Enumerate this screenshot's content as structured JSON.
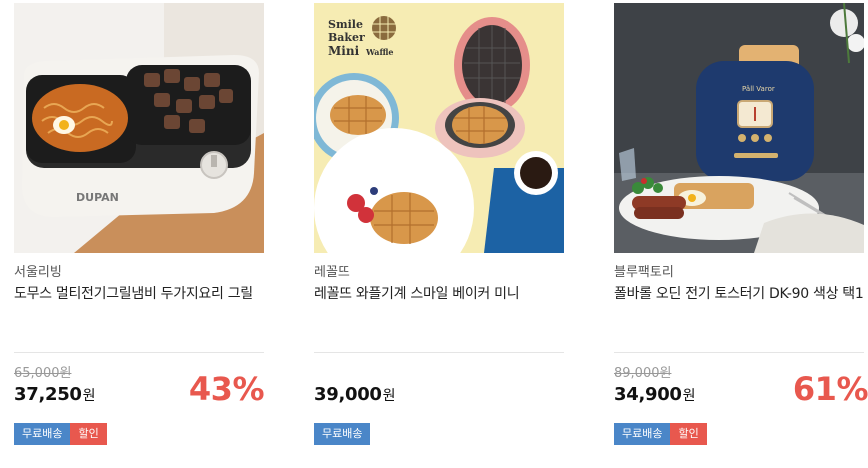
{
  "products": [
    {
      "shop": "서울리빙",
      "title": "도무스 멀티전기그릴냄비 두가지요리 그릴",
      "original_price": "65,000원",
      "price": "37,250",
      "currency": "원",
      "discount": "43%",
      "badges": [
        "무료배송",
        "할인"
      ],
      "image_brand": "DUPAN"
    },
    {
      "shop": "레꼴뜨",
      "title": "레꼴뜨 와플기계 스마일 베이커 미니",
      "original_price": "",
      "price": "39,000",
      "currency": "원",
      "discount": "",
      "badges": [
        "무료배송"
      ],
      "image_text": [
        "Smile",
        "Baker",
        "Mini",
        "Waffle"
      ]
    },
    {
      "shop": "블루팩토리",
      "title": "폴바롤 오딘 전기 토스터기 DK-90 색상 택1",
      "original_price": "89,000원",
      "price": "34,900",
      "currency": "원",
      "discount": "61%",
      "badges": [
        "무료배송",
        "할인"
      ],
      "image_brand": "Pâll Varor"
    }
  ],
  "colors": {
    "discount": "#e8584e",
    "free_shipping_badge": "#4a86c8",
    "sale_badge": "#e8584e"
  }
}
